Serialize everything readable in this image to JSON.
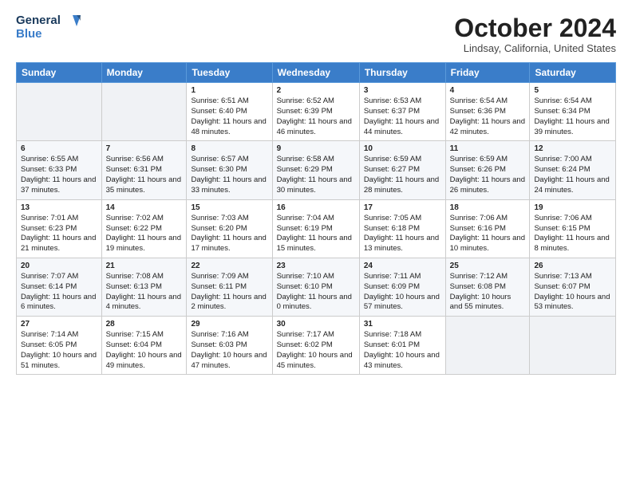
{
  "logo": {
    "line1": "General",
    "line2": "Blue"
  },
  "title": "October 2024",
  "location": "Lindsay, California, United States",
  "days_header": [
    "Sunday",
    "Monday",
    "Tuesday",
    "Wednesday",
    "Thursday",
    "Friday",
    "Saturday"
  ],
  "weeks": [
    [
      {
        "num": "",
        "info": ""
      },
      {
        "num": "",
        "info": ""
      },
      {
        "num": "1",
        "info": "Sunrise: 6:51 AM\nSunset: 6:40 PM\nDaylight: 11 hours and 48 minutes."
      },
      {
        "num": "2",
        "info": "Sunrise: 6:52 AM\nSunset: 6:39 PM\nDaylight: 11 hours and 46 minutes."
      },
      {
        "num": "3",
        "info": "Sunrise: 6:53 AM\nSunset: 6:37 PM\nDaylight: 11 hours and 44 minutes."
      },
      {
        "num": "4",
        "info": "Sunrise: 6:54 AM\nSunset: 6:36 PM\nDaylight: 11 hours and 42 minutes."
      },
      {
        "num": "5",
        "info": "Sunrise: 6:54 AM\nSunset: 6:34 PM\nDaylight: 11 hours and 39 minutes."
      }
    ],
    [
      {
        "num": "6",
        "info": "Sunrise: 6:55 AM\nSunset: 6:33 PM\nDaylight: 11 hours and 37 minutes."
      },
      {
        "num": "7",
        "info": "Sunrise: 6:56 AM\nSunset: 6:31 PM\nDaylight: 11 hours and 35 minutes."
      },
      {
        "num": "8",
        "info": "Sunrise: 6:57 AM\nSunset: 6:30 PM\nDaylight: 11 hours and 33 minutes."
      },
      {
        "num": "9",
        "info": "Sunrise: 6:58 AM\nSunset: 6:29 PM\nDaylight: 11 hours and 30 minutes."
      },
      {
        "num": "10",
        "info": "Sunrise: 6:59 AM\nSunset: 6:27 PM\nDaylight: 11 hours and 28 minutes."
      },
      {
        "num": "11",
        "info": "Sunrise: 6:59 AM\nSunset: 6:26 PM\nDaylight: 11 hours and 26 minutes."
      },
      {
        "num": "12",
        "info": "Sunrise: 7:00 AM\nSunset: 6:24 PM\nDaylight: 11 hours and 24 minutes."
      }
    ],
    [
      {
        "num": "13",
        "info": "Sunrise: 7:01 AM\nSunset: 6:23 PM\nDaylight: 11 hours and 21 minutes."
      },
      {
        "num": "14",
        "info": "Sunrise: 7:02 AM\nSunset: 6:22 PM\nDaylight: 11 hours and 19 minutes."
      },
      {
        "num": "15",
        "info": "Sunrise: 7:03 AM\nSunset: 6:20 PM\nDaylight: 11 hours and 17 minutes."
      },
      {
        "num": "16",
        "info": "Sunrise: 7:04 AM\nSunset: 6:19 PM\nDaylight: 11 hours and 15 minutes."
      },
      {
        "num": "17",
        "info": "Sunrise: 7:05 AM\nSunset: 6:18 PM\nDaylight: 11 hours and 13 minutes."
      },
      {
        "num": "18",
        "info": "Sunrise: 7:06 AM\nSunset: 6:16 PM\nDaylight: 11 hours and 10 minutes."
      },
      {
        "num": "19",
        "info": "Sunrise: 7:06 AM\nSunset: 6:15 PM\nDaylight: 11 hours and 8 minutes."
      }
    ],
    [
      {
        "num": "20",
        "info": "Sunrise: 7:07 AM\nSunset: 6:14 PM\nDaylight: 11 hours and 6 minutes."
      },
      {
        "num": "21",
        "info": "Sunrise: 7:08 AM\nSunset: 6:13 PM\nDaylight: 11 hours and 4 minutes."
      },
      {
        "num": "22",
        "info": "Sunrise: 7:09 AM\nSunset: 6:11 PM\nDaylight: 11 hours and 2 minutes."
      },
      {
        "num": "23",
        "info": "Sunrise: 7:10 AM\nSunset: 6:10 PM\nDaylight: 11 hours and 0 minutes."
      },
      {
        "num": "24",
        "info": "Sunrise: 7:11 AM\nSunset: 6:09 PM\nDaylight: 10 hours and 57 minutes."
      },
      {
        "num": "25",
        "info": "Sunrise: 7:12 AM\nSunset: 6:08 PM\nDaylight: 10 hours and 55 minutes."
      },
      {
        "num": "26",
        "info": "Sunrise: 7:13 AM\nSunset: 6:07 PM\nDaylight: 10 hours and 53 minutes."
      }
    ],
    [
      {
        "num": "27",
        "info": "Sunrise: 7:14 AM\nSunset: 6:05 PM\nDaylight: 10 hours and 51 minutes."
      },
      {
        "num": "28",
        "info": "Sunrise: 7:15 AM\nSunset: 6:04 PM\nDaylight: 10 hours and 49 minutes."
      },
      {
        "num": "29",
        "info": "Sunrise: 7:16 AM\nSunset: 6:03 PM\nDaylight: 10 hours and 47 minutes."
      },
      {
        "num": "30",
        "info": "Sunrise: 7:17 AM\nSunset: 6:02 PM\nDaylight: 10 hours and 45 minutes."
      },
      {
        "num": "31",
        "info": "Sunrise: 7:18 AM\nSunset: 6:01 PM\nDaylight: 10 hours and 43 minutes."
      },
      {
        "num": "",
        "info": ""
      },
      {
        "num": "",
        "info": ""
      }
    ]
  ]
}
